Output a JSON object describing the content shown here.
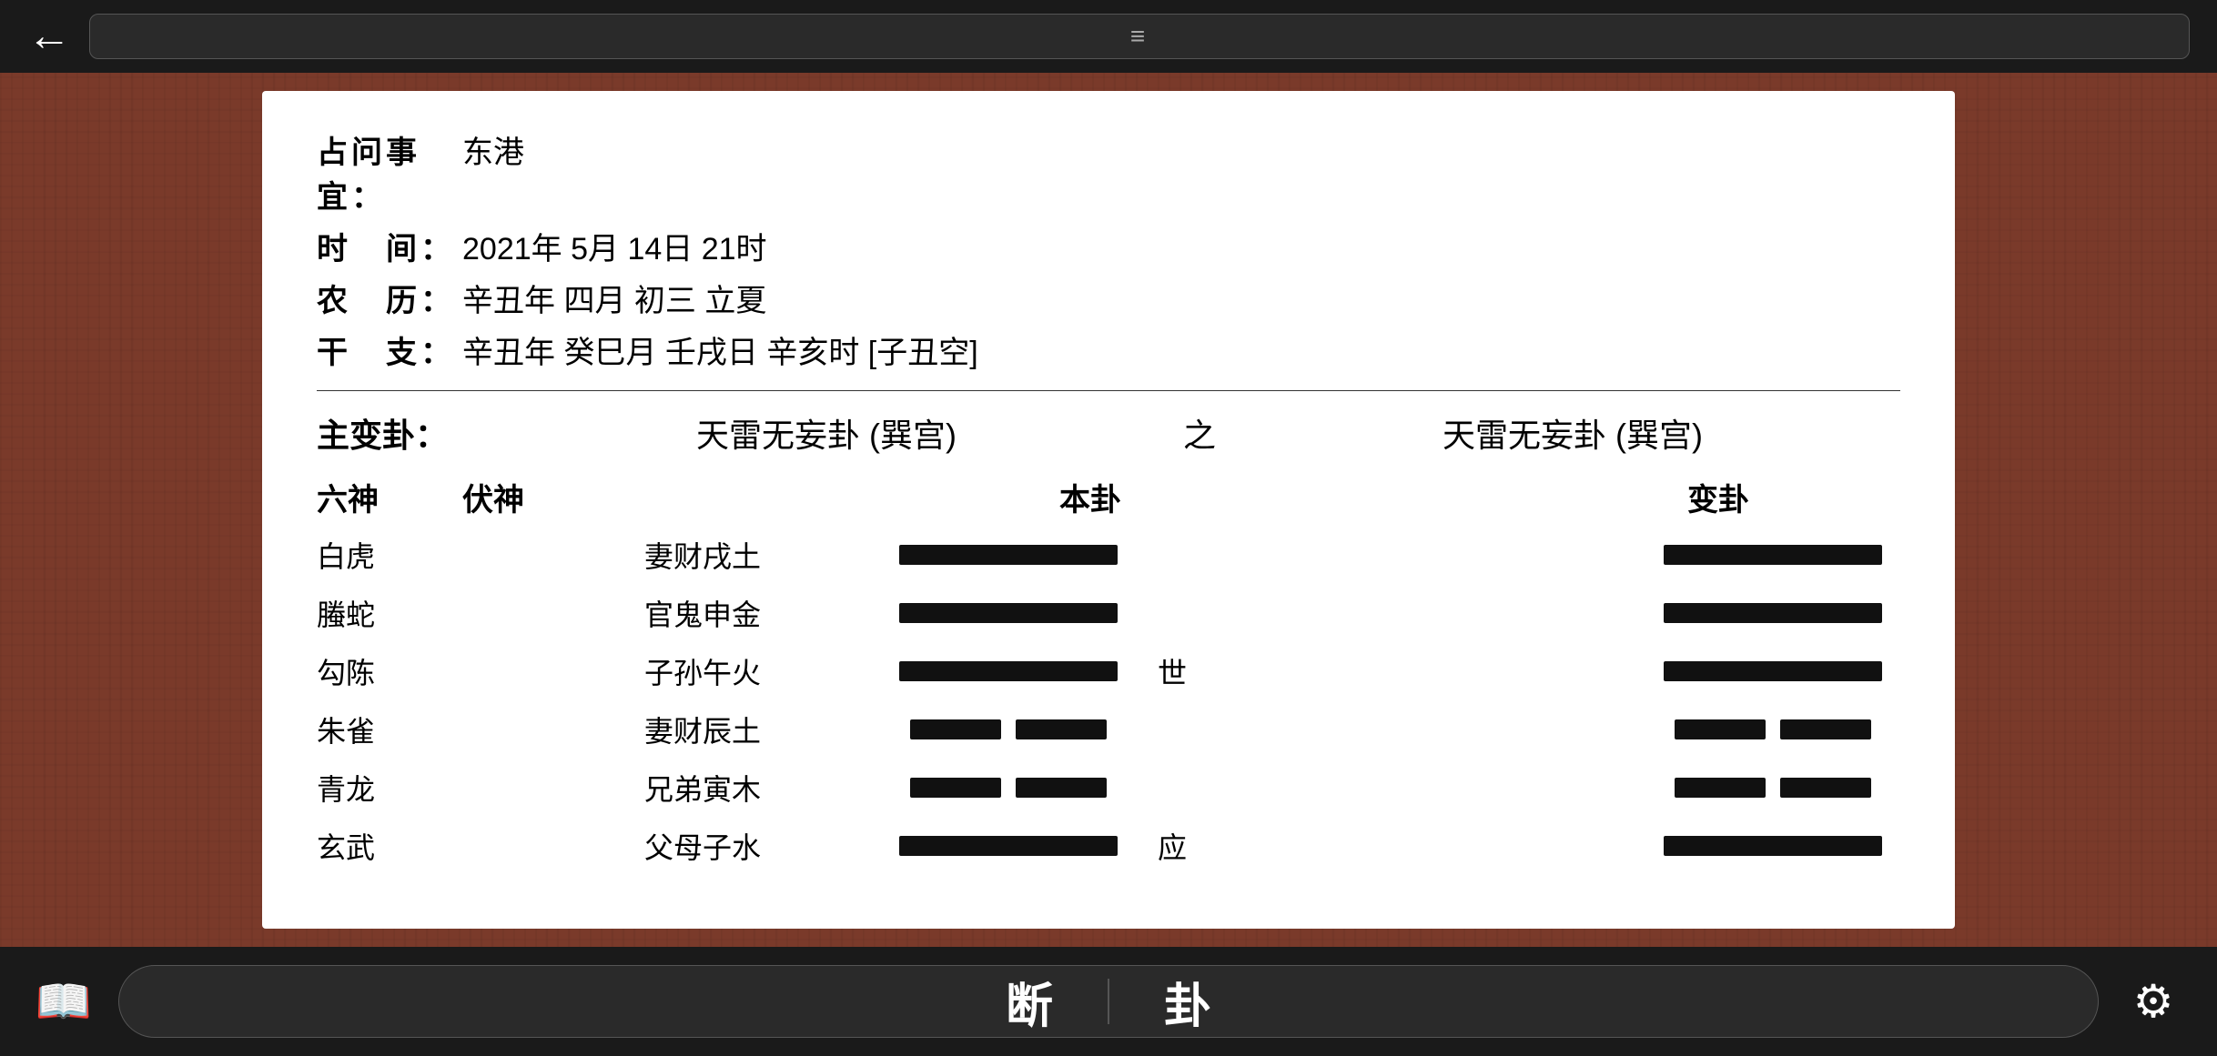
{
  "topBar": {
    "backLabel": "←",
    "hamburger": "≡"
  },
  "info": {
    "subject_label": "占问事宜：",
    "subject_value": "东港",
    "time_label": "时　间：",
    "time_value": "2021年 5月 14日 21时",
    "lunar_label": "农　历：",
    "lunar_value": "辛丑年 四月 初三 立夏",
    "ganzhi_label": "干　支：",
    "ganzhi_value": "辛丑年 癸巳月 壬戌日 辛亥时 [子丑空]"
  },
  "gua": {
    "main_label": "主变卦：",
    "bengua_name": "天雷无妄卦 (巽宫)",
    "zhi": "之",
    "biangua_name": "天雷无妄卦 (巽宫)",
    "col_liushen": "六神",
    "col_fushen": "伏神",
    "col_bengua": "本卦",
    "col_biangua": "变卦",
    "rows": [
      {
        "liushen": "白虎",
        "fushen": "",
        "yao_name": "妻财戌土",
        "yao_type": "solid",
        "marker": "",
        "bian_type": "solid"
      },
      {
        "liushen": "螣蛇",
        "fushen": "",
        "yao_name": "官鬼申金",
        "yao_type": "solid",
        "marker": "",
        "bian_type": "solid"
      },
      {
        "liushen": "勾陈",
        "fushen": "",
        "yao_name": "子孙午火",
        "yao_type": "solid",
        "marker": "世",
        "bian_type": "solid"
      },
      {
        "liushen": "朱雀",
        "fushen": "",
        "yao_name": "妻财辰土",
        "yao_type": "broken",
        "marker": "",
        "bian_type": "broken"
      },
      {
        "liushen": "青龙",
        "fushen": "",
        "yao_name": "兄弟寅木",
        "yao_type": "broken",
        "marker": "",
        "bian_type": "broken"
      },
      {
        "liushen": "玄武",
        "fushen": "",
        "yao_name": "父母子水",
        "yao_type": "solid",
        "marker": "应",
        "bian_type": "solid"
      }
    ]
  },
  "bottomBar": {
    "bookIcon": "📖",
    "button1": "断",
    "button2": "卦",
    "gearIcon": "⚙"
  }
}
